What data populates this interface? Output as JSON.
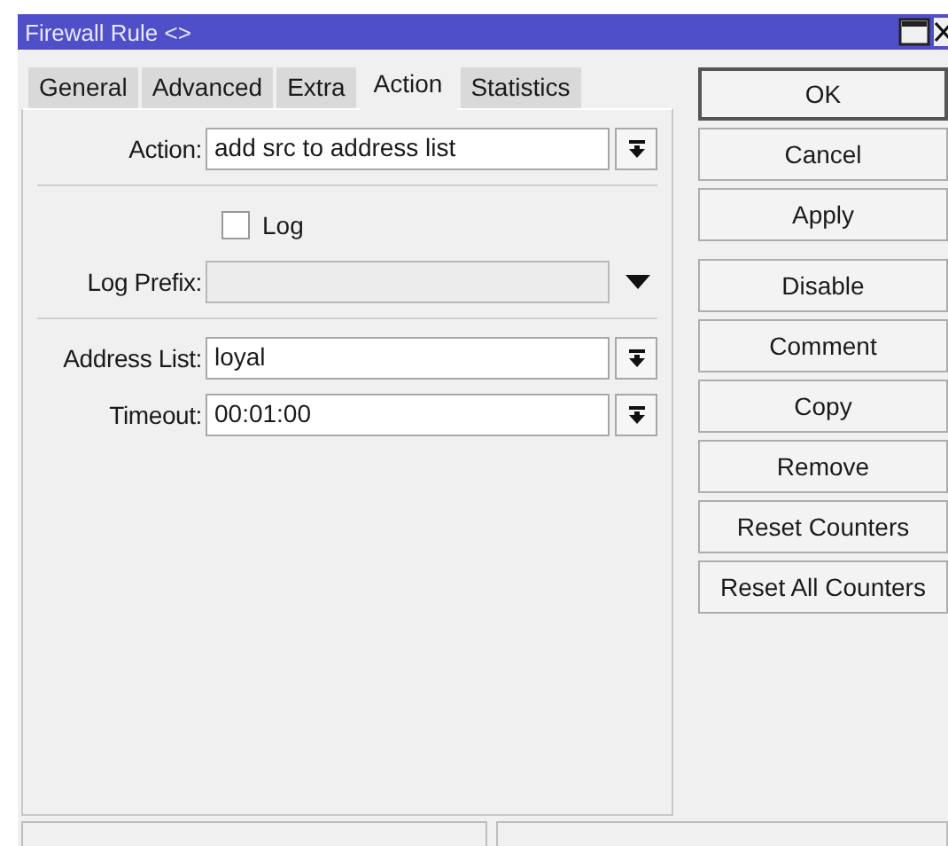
{
  "window": {
    "title": "Firewall Rule <>"
  },
  "tabs": [
    {
      "label": "General",
      "selected": false
    },
    {
      "label": "Advanced",
      "selected": false
    },
    {
      "label": "Extra",
      "selected": false
    },
    {
      "label": "Action",
      "selected": true
    },
    {
      "label": "Statistics",
      "selected": false
    }
  ],
  "form": [
    {
      "kind": "select",
      "label": "Action:",
      "value": "add src to address list",
      "disabled": false
    },
    {
      "kind": "separator"
    },
    {
      "kind": "checkbox",
      "label": "Log",
      "checked": false
    },
    {
      "kind": "expand",
      "label": "Log Prefix:",
      "disabled": true
    },
    {
      "kind": "separator"
    },
    {
      "kind": "select",
      "label": "Address List:",
      "value": "loyal",
      "disabled": false
    },
    {
      "kind": "select",
      "label": "Timeout:",
      "value": "00:01:00",
      "disabled": false
    }
  ],
  "button_groups": [
    [
      {
        "label": "OK",
        "default": true
      },
      {
        "label": "Cancel",
        "default": false
      },
      {
        "label": "Apply",
        "default": false
      }
    ],
    [
      {
        "label": "Disable",
        "default": false
      },
      {
        "label": "Comment",
        "default": false
      },
      {
        "label": "Copy",
        "default": false
      },
      {
        "label": "Remove",
        "default": false
      },
      {
        "label": "Reset Counters",
        "default": false
      },
      {
        "label": "Reset All Counters",
        "default": false
      }
    ]
  ]
}
